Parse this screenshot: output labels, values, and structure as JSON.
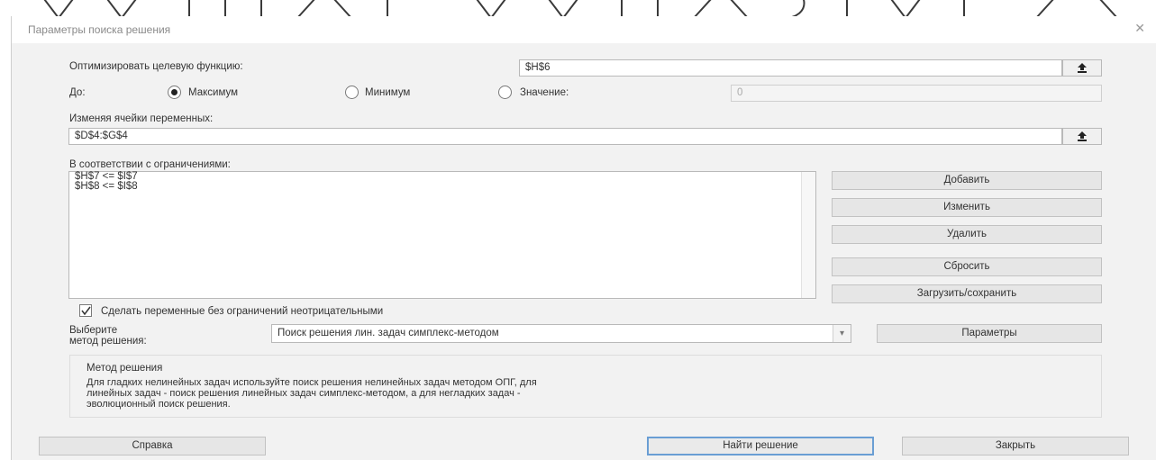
{
  "dialog": {
    "title": "Параметры поиска решения",
    "close_icon": "close-icon"
  },
  "objective": {
    "label": "Оптимизировать целевую функцию:",
    "value": "$H$6"
  },
  "to": {
    "label": "До:",
    "options": [
      {
        "label": "Максимум",
        "checked": true
      },
      {
        "label": "Минимум",
        "checked": false
      },
      {
        "label": "Значение:",
        "checked": false
      }
    ],
    "value_field": "0"
  },
  "variables": {
    "label": "Изменяя ячейки переменных:",
    "value": "$D$4:$G$4"
  },
  "constraints": {
    "label": "В соответствии с ограничениями:",
    "items": [
      "$H$7 <= $I$7",
      "$H$8 <= $I$8"
    ]
  },
  "buttons": {
    "add": "Добавить",
    "change": "Изменить",
    "delete": "Удалить",
    "reset": "Сбросить",
    "load_save": "Загрузить/сохранить",
    "options": "Параметры",
    "help": "Справка",
    "solve": "Найти решение",
    "close": "Закрыть"
  },
  "nonnegative": {
    "label": "Сделать переменные без ограничений неотрицательными",
    "checked": true
  },
  "method": {
    "label_line1": "Выберите",
    "label_line2": "метод решения:",
    "selected": "Поиск решения лин. задач симплекс-методом"
  },
  "method_info": {
    "title": "Метод решения",
    "line1": "Для гладких нелинейных задач используйте поиск решения нелинейных задач методом ОПГ, для",
    "line2": "линейных задач - поиск решения линейных задач симплекс-методом, а для негладких задач -",
    "line3": "эволюционный поиск решения."
  }
}
